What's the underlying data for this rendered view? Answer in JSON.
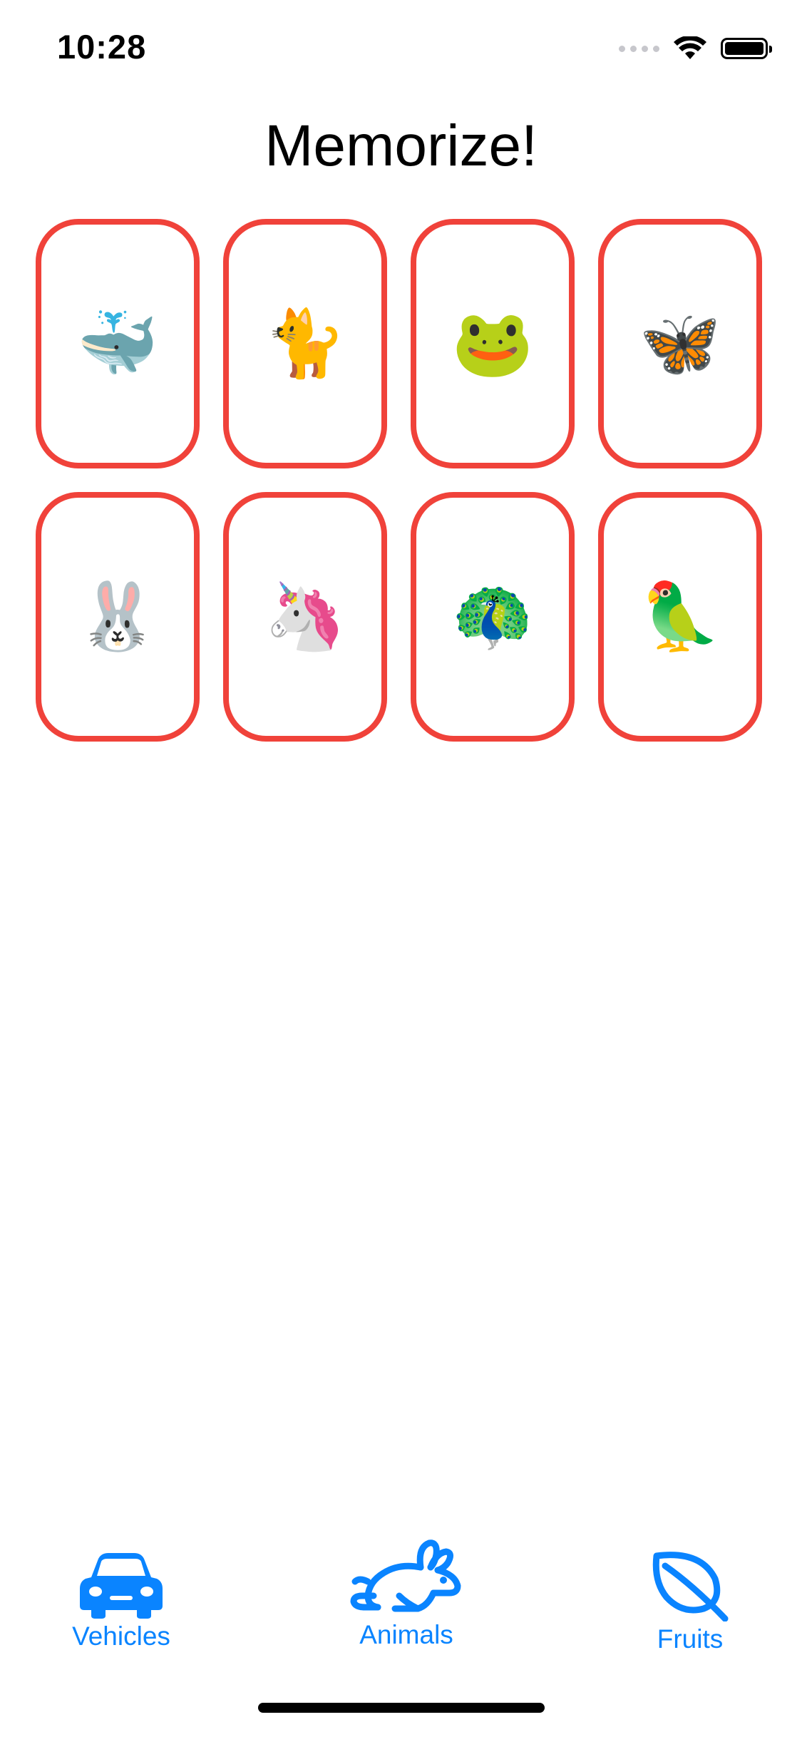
{
  "status_bar": {
    "time": "10:28",
    "icons": [
      "cellular-signal-icon",
      "wifi-icon",
      "battery-icon"
    ]
  },
  "title": "Memorize!",
  "cards": [
    {
      "emoji": "🐳",
      "name": "whale"
    },
    {
      "emoji": "🐈",
      "name": "cat"
    },
    {
      "emoji": "🐸",
      "name": "frog"
    },
    {
      "emoji": "🦋",
      "name": "butterfly"
    },
    {
      "emoji": "🐰",
      "name": "rabbit"
    },
    {
      "emoji": "🦄",
      "name": "unicorn"
    },
    {
      "emoji": "🦚",
      "name": "peacock"
    },
    {
      "emoji": "🦜",
      "name": "parrot"
    }
  ],
  "tabs": [
    {
      "label": "Vehicles",
      "icon": "car-icon"
    },
    {
      "label": "Animals",
      "icon": "hare-icon"
    },
    {
      "label": "Fruits",
      "icon": "leaf-icon"
    }
  ],
  "colors": {
    "card_border": "#f0423a",
    "accent": "#0a84ff",
    "background": "#ffffff"
  }
}
